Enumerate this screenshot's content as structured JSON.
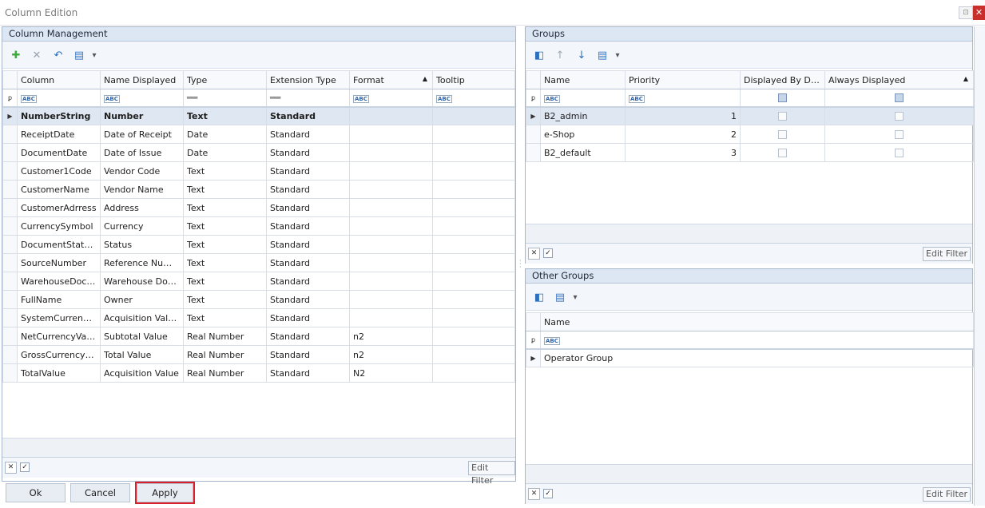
{
  "window": {
    "title": "Column Edition",
    "maximize_glyph": "⊡",
    "close_glyph": "✕"
  },
  "column_management": {
    "header": "Column Management",
    "toolbar": [
      {
        "name": "add-icon",
        "glyph": "✚",
        "color": "#3caa3c"
      },
      {
        "name": "delete-icon",
        "glyph": "✕",
        "color": "#9aa2ad"
      },
      {
        "name": "undo-icon",
        "glyph": "↶",
        "color": "#2e6fc0"
      },
      {
        "name": "layout-icon",
        "glyph": "▤",
        "color": "#3d78c4"
      },
      {
        "name": "dropdown-arrow-icon",
        "glyph": "▾",
        "color": "#555555"
      }
    ],
    "columns": [
      "Column",
      "Name Displayed",
      "Type",
      "Extension Type",
      "Format",
      "Tooltip"
    ],
    "sort_glyph": "▲",
    "filter_pin": "ꝑ",
    "row_indicator": "▶",
    "rows": [
      {
        "column": "NumberString",
        "name_displayed": "Number",
        "type": "Text",
        "extension_type": "Standard",
        "format": "",
        "tooltip": ""
      },
      {
        "column": "ReceiptDate",
        "name_displayed": "Date of Receipt",
        "type": "Date",
        "extension_type": "Standard",
        "format": "",
        "tooltip": ""
      },
      {
        "column": "DocumentDate",
        "name_displayed": "Date of Issue",
        "type": "Date",
        "extension_type": "Standard",
        "format": "",
        "tooltip": ""
      },
      {
        "column": "Customer1Code",
        "name_displayed": "Vendor Code",
        "type": "Text",
        "extension_type": "Standard",
        "format": "",
        "tooltip": ""
      },
      {
        "column": "CustomerName",
        "name_displayed": "Vendor Name",
        "type": "Text",
        "extension_type": "Standard",
        "format": "",
        "tooltip": ""
      },
      {
        "column": "CustomerAdrress",
        "name_displayed": "Address",
        "type": "Text",
        "extension_type": "Standard",
        "format": "",
        "tooltip": ""
      },
      {
        "column": "CurrencySymbol",
        "name_displayed": "Currency",
        "type": "Text",
        "extension_type": "Standard",
        "format": "",
        "tooltip": ""
      },
      {
        "column": "DocumentStateN...",
        "name_displayed": "Status",
        "type": "Text",
        "extension_type": "Standard",
        "format": "",
        "tooltip": ""
      },
      {
        "column": "SourceNumber",
        "name_displayed": "Reference Number",
        "type": "Text",
        "extension_type": "Standard",
        "format": "",
        "tooltip": ""
      },
      {
        "column": "WarehouseDocu...",
        "name_displayed": "Warehouse Doc...",
        "type": "Text",
        "extension_type": "Standard",
        "format": "",
        "tooltip": ""
      },
      {
        "column": "FullName",
        "name_displayed": "Owner",
        "type": "Text",
        "extension_type": "Standard",
        "format": "",
        "tooltip": ""
      },
      {
        "column": "SystemCurrencyS...",
        "name_displayed": "Acquisition Valu...",
        "type": "Text",
        "extension_type": "Standard",
        "format": "",
        "tooltip": ""
      },
      {
        "column": "NetCurrencyValue",
        "name_displayed": "Subtotal Value",
        "type": "Real Number",
        "extension_type": "Standard",
        "format": "n2",
        "tooltip": ""
      },
      {
        "column": "GrossCurrencyVa...",
        "name_displayed": "Total Value",
        "type": "Real Number",
        "extension_type": "Standard",
        "format": "n2",
        "tooltip": ""
      },
      {
        "column": "TotalValue",
        "name_displayed": "Acquisition Value",
        "type": "Real Number",
        "extension_type": "Standard",
        "format": "N2",
        "tooltip": ""
      }
    ],
    "footer": {
      "clear_glyph": "✕",
      "check_glyph": "✓",
      "edit_filter": "Edit Filter"
    }
  },
  "groups": {
    "header": "Groups",
    "columns": [
      "Name",
      "Priority",
      "Displayed By Def...",
      "Always Displayed"
    ],
    "rows": [
      {
        "name": "B2_admin",
        "priority": "1"
      },
      {
        "name": "e-Shop",
        "priority": "2"
      },
      {
        "name": "B2_default",
        "priority": "3"
      }
    ],
    "footer": {
      "edit_filter": "Edit Filter"
    }
  },
  "other_groups": {
    "header": "Other Groups",
    "columns": [
      "Name"
    ],
    "rows": [
      {
        "name": "Operator Group"
      }
    ],
    "footer": {
      "edit_filter": "Edit Filter"
    }
  },
  "buttons": {
    "ok": "Ok",
    "cancel": "Cancel",
    "apply": "Apply"
  },
  "abc_glyph": "ABC",
  "eq_glyph": "══"
}
